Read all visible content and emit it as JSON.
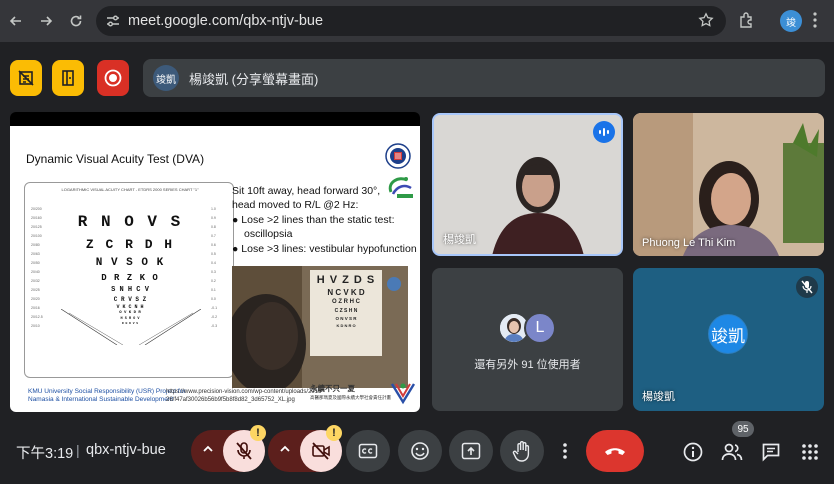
{
  "browser": {
    "url": "meet.google.com/qbx-ntjv-bue",
    "profile_initial": "竣"
  },
  "presenting": {
    "avatar_initial": "竣凱",
    "text": "楊竣凱 (分享螢幕畫面)"
  },
  "slide": {
    "title": "Dynamic Visual Acuity Test (DVA)",
    "chart_header": "LOGARITHMIC VISUAL ACUITY CHART - ETDRS 2000 SERIES CHART \"1\"",
    "chart_rows": [
      "R N O V S",
      "Z C R D H",
      "N V S O K",
      "D R Z K O",
      "S N H C V",
      "C R V S Z",
      "V K C N H",
      "O V K D R",
      "H S R O V",
      "R H D V S"
    ],
    "instructions": [
      "Sit 10ft away, head forward 30°,",
      "head moved to R/L @2 Hz:"
    ],
    "bullets": [
      {
        "lead": "Lose >2 lines than the static test:",
        "cont": "oscillopsia"
      },
      {
        "lead": "Lose >3 lines: vestibular hypofunction",
        "cont": ""
      }
    ],
    "photo_chart_rows": [
      "H V Z D S",
      "N C V K D",
      "O Z R H C",
      "C Z S H N",
      "O N V S R",
      "K D N R O"
    ],
    "footer_left": [
      "KMU University Social Responsibility (USR) Project for",
      "Namasia & International Sustainable Development"
    ],
    "footer_url": [
      "https://www.precision-vision.com/wp-content/uploads/2015",
      "26/f47af30026b56b9f5b8f8d82_3d65752_XL.jpg"
    ],
    "footer_right": [
      "永續不只一夏",
      "高醫那瑪夏及國際永續大學社會責任計畫"
    ]
  },
  "tiles": [
    {
      "name": "楊竣凱",
      "speaking": true
    },
    {
      "name": "Phuong Le Thi Kim"
    },
    {
      "others_text": "還有另外 91 位使用者",
      "avatar_letter": "L"
    },
    {
      "name": "楊竣凱",
      "avatar_text": "竣凱",
      "muted": true
    }
  ],
  "bottom": {
    "time": "下午3:19",
    "separator": "|",
    "meeting_code": "qbx-ntjv-bue",
    "participants_count": "95",
    "warn_symbol": "!"
  },
  "colors": {
    "end_call": "#dc362e",
    "top_buttons": "#fbbc04",
    "record_button": "#d93025",
    "mic_off_bg": "#f9dedc"
  },
  "icons": [
    "back-arrow-icon",
    "forward-arrow-icon",
    "reload-icon",
    "site-settings-icon",
    "bookmark-star-icon",
    "extensions-icon",
    "kebab-menu-icon",
    "notes-icon",
    "activities-icon",
    "record-icon",
    "mic-off-icon",
    "camera-off-icon",
    "captions-icon",
    "emoji-icon",
    "present-icon",
    "raise-hand-icon",
    "more-options-icon",
    "end-call-icon",
    "info-icon",
    "people-icon",
    "chat-icon",
    "apps-grid-icon"
  ]
}
